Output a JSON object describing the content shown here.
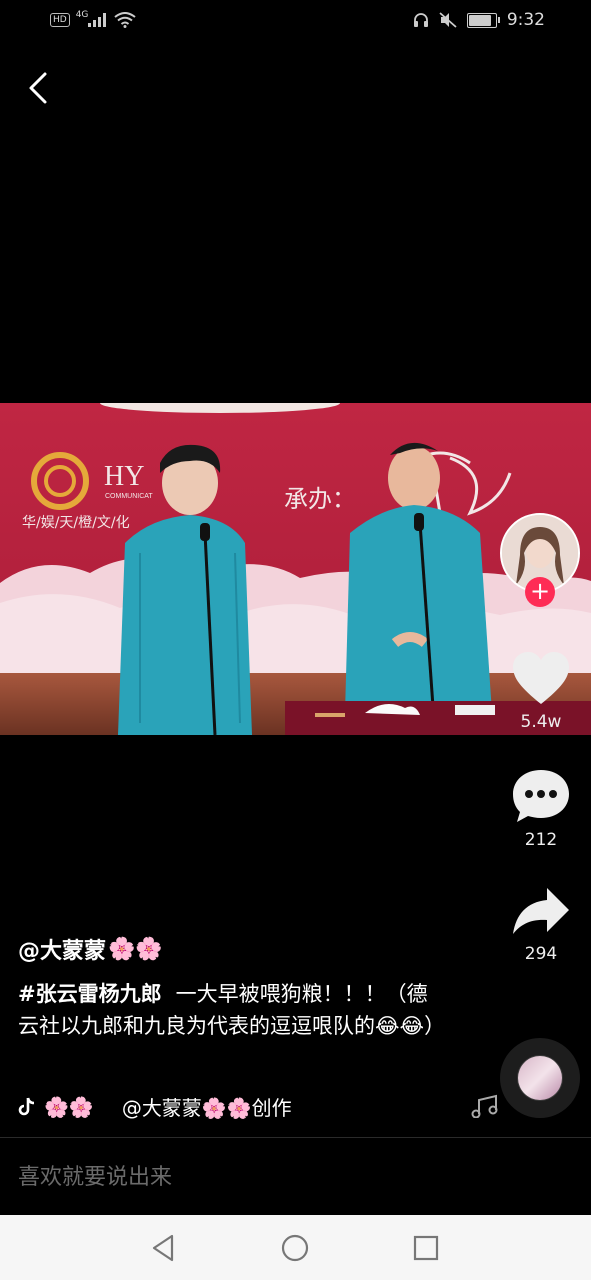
{
  "status_bar": {
    "hd_label": "HD",
    "network_label": "4G",
    "time": "9:32"
  },
  "video": {
    "logo_text": "HY",
    "logo_subtext": "COMMUNICAT",
    "banner_text": "华/娱/天/橙/文/化",
    "organizer_label": "承办："
  },
  "actions": {
    "likes": "5.4w",
    "comments": "212",
    "shares": "294",
    "follow_symbol": "+"
  },
  "caption": {
    "author": "@大蒙蒙",
    "author_flowers": "🌸🌸",
    "hashtag": "#张云雷杨九郎",
    "description": "一大早被喂狗粮！！！（德云社以九郎和九良为代表的逗逗哏队的😂😂）"
  },
  "music": {
    "prefix_flowers": "🌸🌸",
    "text": "@大蒙蒙🌸🌸创作"
  },
  "comment": {
    "placeholder": "喜欢就要说出来"
  },
  "colors": {
    "accent": "#fe2c55",
    "background": "#000000",
    "stage_red": "#b0203a",
    "robe_teal": "#2aa3b9"
  },
  "icons": [
    "back-icon",
    "heart-icon",
    "comment-icon",
    "share-icon",
    "tiktok-icon",
    "music-note-icon",
    "headphones-icon",
    "mute-icon",
    "signal-icon",
    "wifi-icon",
    "battery-icon"
  ]
}
